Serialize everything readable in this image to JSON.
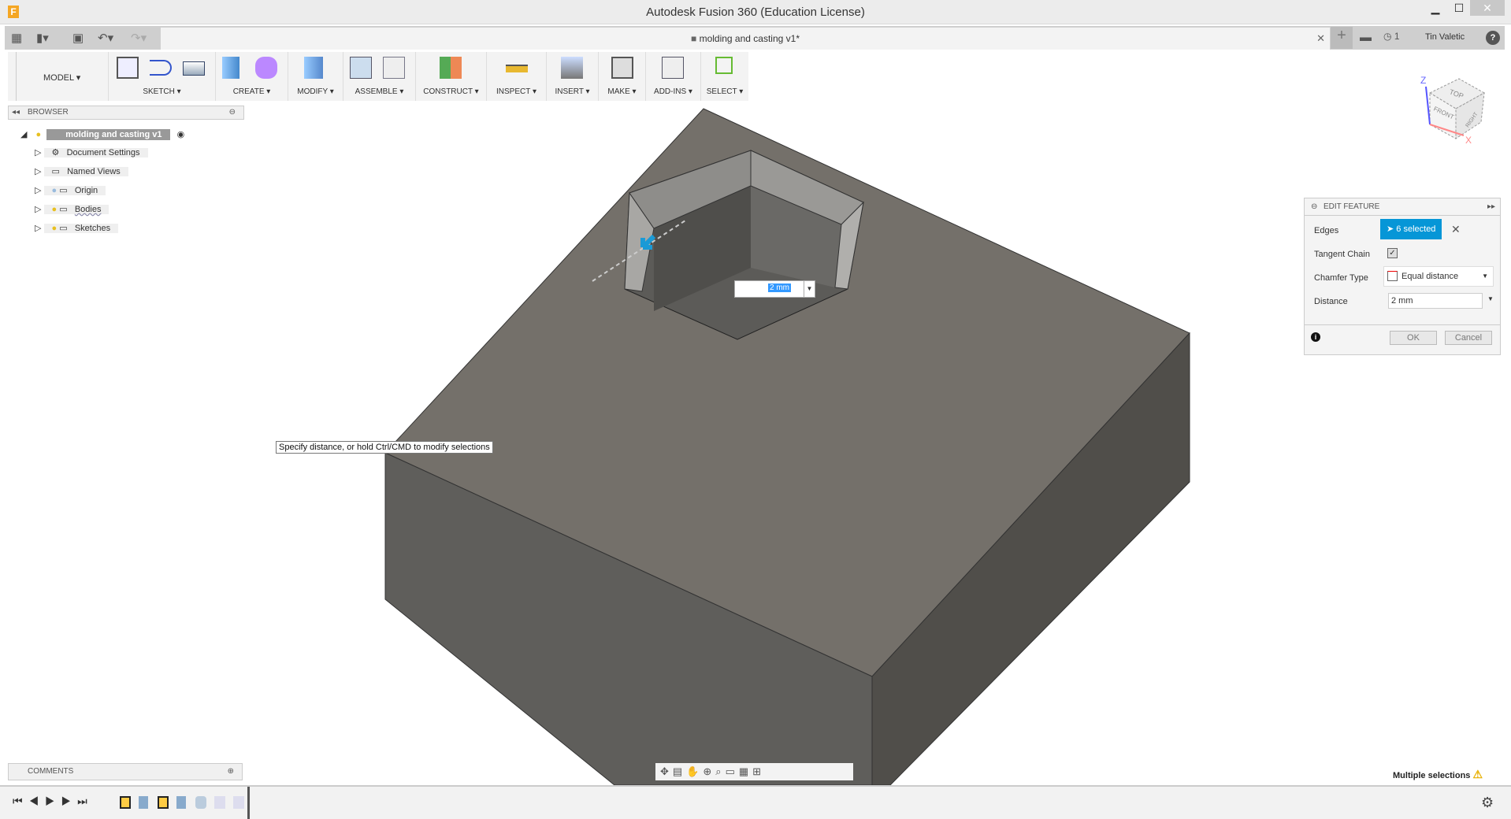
{
  "window": {
    "title": "Autodesk Fusion 360 (Education License)",
    "logo": "F",
    "minimize": "▁",
    "maximize": "☐",
    "close": "✕"
  },
  "tabbar": {
    "doc_tab": "molding and casting v1*",
    "close": "✕",
    "new_tab": "+",
    "jobs_count": "1",
    "user": "Tin Valetic",
    "help": "?"
  },
  "toolbar": {
    "workspace": "MODEL ▾",
    "groups": [
      {
        "label": "SKETCH ▾"
      },
      {
        "label": "CREATE ▾"
      },
      {
        "label": "MODIFY ▾"
      },
      {
        "label": "ASSEMBLE ▾"
      },
      {
        "label": "CONSTRUCT ▾"
      },
      {
        "label": "INSPECT ▾"
      },
      {
        "label": "INSERT ▾"
      },
      {
        "label": "MAKE ▾"
      },
      {
        "label": "ADD-INS ▾"
      },
      {
        "label": "SELECT ▾"
      }
    ]
  },
  "browser": {
    "title": "BROWSER",
    "root": "molding and casting v1",
    "items": [
      {
        "label": "Document Settings"
      },
      {
        "label": "Named Views"
      },
      {
        "label": "Origin"
      },
      {
        "label": "Bodies"
      },
      {
        "label": "Sketches"
      }
    ]
  },
  "viewcube": {
    "top": "TOP",
    "front": "FRONT",
    "right": "RIGHT",
    "z": "Z",
    "x": "X"
  },
  "canvas": {
    "dimension_value": "2 mm",
    "tooltip": "Specify distance, or hold Ctrl/CMD to modify selections"
  },
  "edit_feature": {
    "title": "EDIT FEATURE",
    "edges_label": "Edges",
    "edges_value": "6 selected",
    "tangent_label": "Tangent Chain",
    "tangent_checked": true,
    "chamfer_label": "Chamfer Type",
    "chamfer_value": "Equal distance",
    "distance_label": "Distance",
    "distance_value": "2 mm",
    "ok": "OK",
    "cancel": "Cancel",
    "accent": "#0696d7"
  },
  "comments": {
    "title": "COMMENTS"
  },
  "status": {
    "message": "Multiple selections",
    "warning": "⚠"
  },
  "colors": {
    "top_face": "#74706a",
    "left_face": "#5e5d5a",
    "right_face": "#4f4d49"
  }
}
